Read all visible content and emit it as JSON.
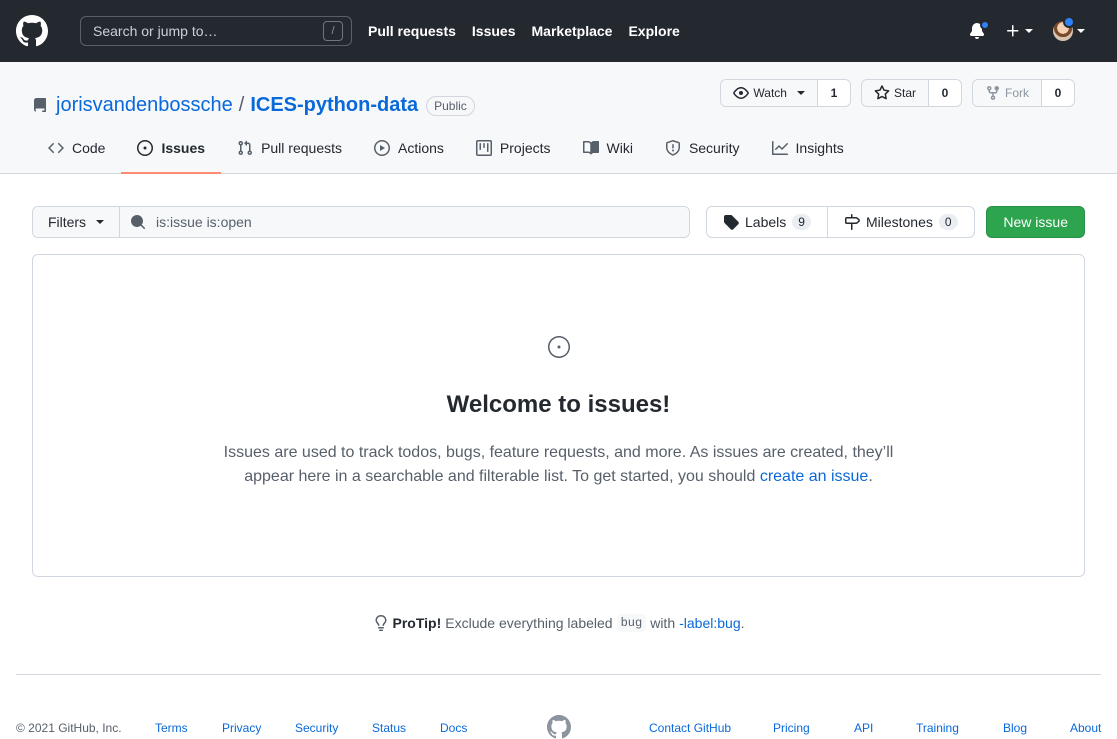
{
  "header": {
    "search_placeholder": "Search or jump to…",
    "search_key": "/",
    "nav": [
      "Pull requests",
      "Issues",
      "Marketplace",
      "Explore"
    ]
  },
  "repo": {
    "owner": "jorisvandenbossche",
    "separator": "/",
    "name": "ICES-python-data",
    "visibility": "Public",
    "watch_label": "Watch",
    "watch_count": "1",
    "star_label": "Star",
    "star_count": "0",
    "fork_label": "Fork",
    "fork_count": "0"
  },
  "tabs": [
    {
      "label": "Code",
      "icon": "code-icon"
    },
    {
      "label": "Issues",
      "icon": "issue-opened-icon",
      "selected": true
    },
    {
      "label": "Pull requests",
      "icon": "git-pull-request-icon"
    },
    {
      "label": "Actions",
      "icon": "play-icon"
    },
    {
      "label": "Projects",
      "icon": "project-icon"
    },
    {
      "label": "Wiki",
      "icon": "book-icon"
    },
    {
      "label": "Security",
      "icon": "shield-icon"
    },
    {
      "label": "Insights",
      "icon": "graph-icon"
    }
  ],
  "toolbar": {
    "filters_label": "Filters",
    "search_value": "is:issue is:open",
    "labels_label": "Labels",
    "labels_count": "9",
    "milestones_label": "Milestones",
    "milestones_count": "0",
    "new_issue_label": "New issue"
  },
  "blankslate": {
    "title": "Welcome to issues!",
    "text": "Issues are used to track todos, bugs, feature requests, and more. As issues are created, they’ll appear here in a searchable and filterable list. To get started, you should",
    "link": "create an issue",
    "end": "."
  },
  "protip": {
    "label": "ProTip!",
    "text": "Exclude everything labeled",
    "code": "bug",
    "with": "with",
    "link": "-label:bug",
    "end": "."
  },
  "footer": {
    "copyright": "© 2021 GitHub, Inc.",
    "links_left": [
      "Terms",
      "Privacy",
      "Security",
      "Status",
      "Docs"
    ],
    "links_right": [
      "Contact GitHub",
      "Pricing",
      "API",
      "Training",
      "Blog",
      "About"
    ]
  },
  "colors": {
    "header_bg": "#24292f",
    "link": "#0969da",
    "primary_button": "#2da44e",
    "selected_tab_underline": "#fd8c73",
    "notification_dot": "#2f81f7"
  }
}
